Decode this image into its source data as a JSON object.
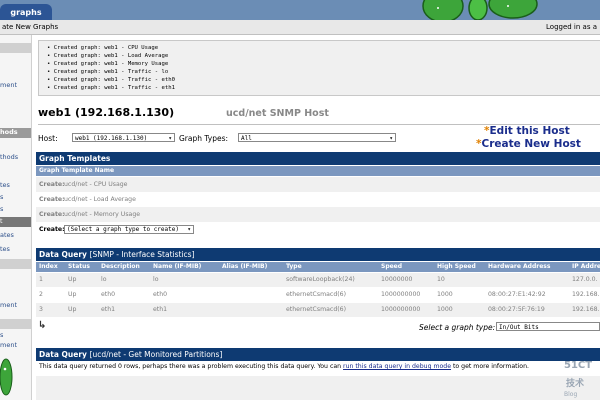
{
  "tabs": {
    "graphs": "graphs"
  },
  "breadcrumb": {
    "left": "ate New Graphs",
    "right": "Logged in as a"
  },
  "sidebar": [
    {
      "label": "",
      "style": "gray"
    },
    {
      "label": "",
      "style": "plain"
    },
    {
      "label": "ment",
      "style": "plain"
    },
    {
      "label": "",
      "style": "plain"
    },
    {
      "label": "hods",
      "style": "hdr"
    },
    {
      "label": "thods",
      "style": "plain"
    },
    {
      "label": "",
      "style": "plain"
    },
    {
      "label": "tes",
      "style": "plain"
    },
    {
      "label": "s",
      "style": "plain"
    },
    {
      "label": "s",
      "style": "plain"
    },
    {
      "label": "t",
      "style": "sel"
    },
    {
      "label": "ates",
      "style": "plain"
    },
    {
      "label": "tes",
      "style": "plain"
    },
    {
      "label": "",
      "style": "gray"
    },
    {
      "label": "",
      "style": "plain"
    },
    {
      "label": "ment",
      "style": "plain"
    },
    {
      "label": "",
      "style": "gray"
    },
    {
      "label": "s",
      "style": "plain"
    },
    {
      "label": "ment",
      "style": "plain"
    }
  ],
  "messages": [
    "• Created graph: web1 - CPU Usage",
    "• Created graph: web1 - Load Average",
    "• Created graph: web1 - Memory Usage",
    "• Created graph: web1 - Traffic - lo",
    "• Created graph: web1 - Traffic - eth0",
    "• Created graph: web1 - Traffic - eth1"
  ],
  "header": {
    "title": "web1 (192.168.1.130)",
    "subtitle": "ucd/net SNMP Host"
  },
  "filters": {
    "host_label": "Host:",
    "host_value": "web1 (192.168.1.130)",
    "graph_types_label": "Graph Types:",
    "graph_types_value": "All"
  },
  "links": {
    "edit_host": "Edit this Host",
    "create_host": "Create New Host",
    "star": "*"
  },
  "graph_templates": {
    "title": "Graph Templates",
    "column": "Graph Template Name",
    "rows": [
      {
        "prefix": "Create:",
        "name": "ucd/net - CPU Usage"
      },
      {
        "prefix": "Create:",
        "name": "ucd/net - Load Average"
      },
      {
        "prefix": "Create:",
        "name": "ucd/net - Memory Usage"
      }
    ],
    "create_label": "Create:",
    "create_select": "(Select a graph type to create)"
  },
  "data_query_1": {
    "title_bold": "Data Query",
    "title_rest": "[SNMP - Interface Statistics]",
    "columns": [
      "Index",
      "Status",
      "Description",
      "Name (IF-MIB)",
      "Alias (IF-MIB)",
      "Type",
      "Speed",
      "High Speed",
      "Hardware Address",
      "IP Addre"
    ],
    "rows": [
      [
        "1",
        "Up",
        "lo",
        "lo",
        "",
        "softwareLoopback(24)",
        "10000000",
        "10",
        "",
        "127.0.0."
      ],
      [
        "2",
        "Up",
        "eth0",
        "eth0",
        "",
        "ethernetCsmacd(6)",
        "1000000000",
        "1000",
        "08:00:27:E1:42:92",
        "192.168."
      ],
      [
        "3",
        "Up",
        "eth1",
        "eth1",
        "",
        "ethernetCsmacd(6)",
        "1000000000",
        "1000",
        "08:00:27:5F:76:19",
        "192.168."
      ]
    ],
    "select_label": "Select a graph type:",
    "select_value": "In/Out Bits"
  },
  "data_query_2": {
    "title_bold": "Data Query",
    "title_rest": "[ucd/net - Get Monitored Partitions]",
    "message_start": "This data query returned 0 rows, perhaps there was a problem executing this data query. You can ",
    "message_link": "run this data query in debug mode",
    "message_end": " to get more information."
  },
  "colors": {
    "section": "#0e3a72",
    "colhead": "#7b97bf",
    "link": "#1a2d8c",
    "star": "#e08000"
  }
}
